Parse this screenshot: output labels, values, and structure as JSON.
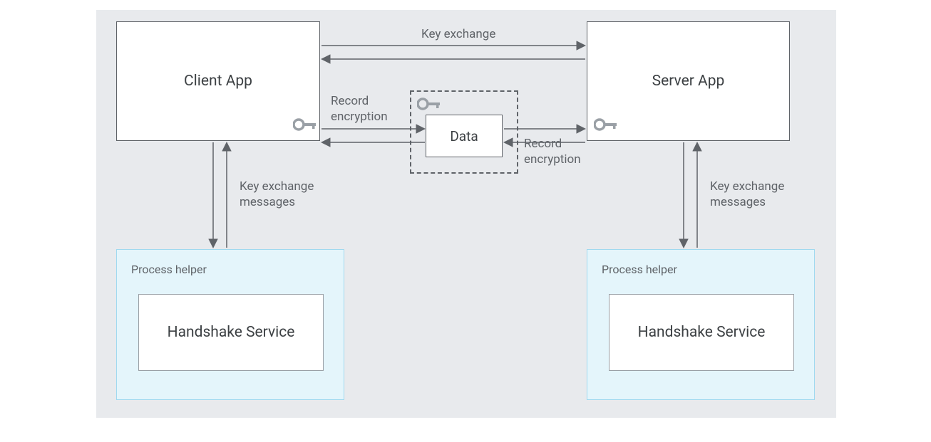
{
  "diagram": {
    "client_app": "Client App",
    "server_app": "Server App",
    "data": "Data",
    "process_helper_label_left": "Process helper",
    "process_helper_label_right": "Process helper",
    "handshake_service_left": "Handshake Service",
    "handshake_service_right": "Handshake Service",
    "labels": {
      "key_exchange": "Key exchange",
      "record_encryption_left": "Record\nencryption",
      "record_encryption_right": "Record\nencryption",
      "key_exchange_messages_left": "Key exchange\nmessages",
      "key_exchange_messages_right": "Key exchange\nmessages"
    }
  },
  "colors": {
    "background": "#e8eaed",
    "border": "#5f6368",
    "text": "#3c4043",
    "label": "#5f6368",
    "helper_bg": "#e4f5fb",
    "helper_border": "#a0d9ef",
    "key_icon": "#9aa0a6"
  }
}
